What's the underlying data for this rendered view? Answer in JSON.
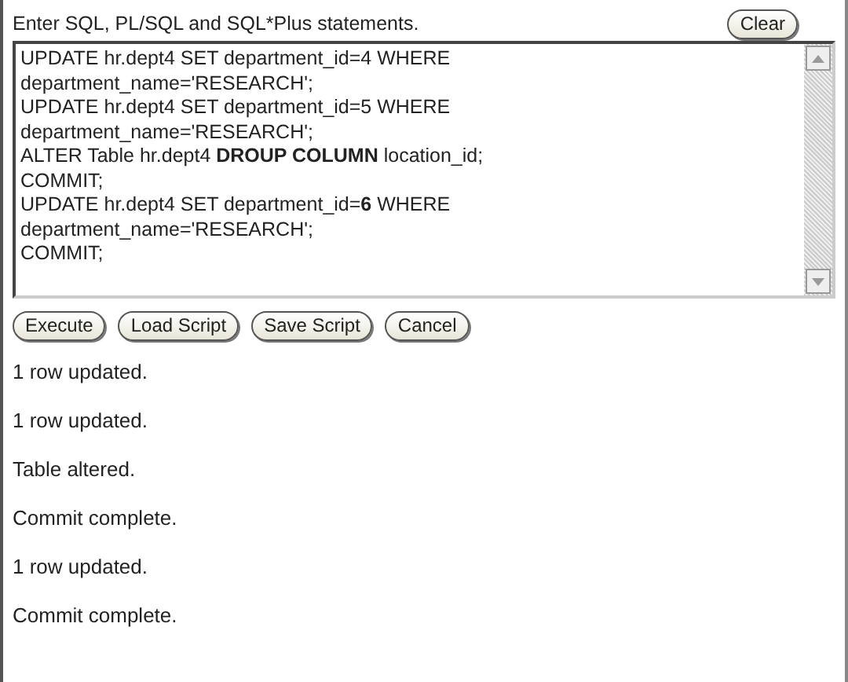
{
  "prompt": "Enter SQL, PL/SQL and SQL*Plus statements.",
  "clear_button": "Clear",
  "editor_lines": [
    "UPDATE hr.dept4 SET department_id=4 WHERE",
    "department_name='RESEARCH';",
    "UPDATE hr.dept4 SET department_id=5 WHERE",
    "department_name='RESEARCH';",
    "ALTER Table hr.dept4 **DROUP COLUMN** location_id;",
    "COMMIT;",
    "UPDATE hr.dept4 SET department_id=**6** WHERE",
    "department_name='RESEARCH';",
    "COMMIT;"
  ],
  "buttons": [
    "Execute",
    "Load Script",
    "Save Script",
    "Cancel"
  ],
  "output": [
    "1 row updated.",
    "1 row updated.",
    "Table altered.",
    "Commit complete.",
    "1 row updated.",
    "Commit complete."
  ]
}
